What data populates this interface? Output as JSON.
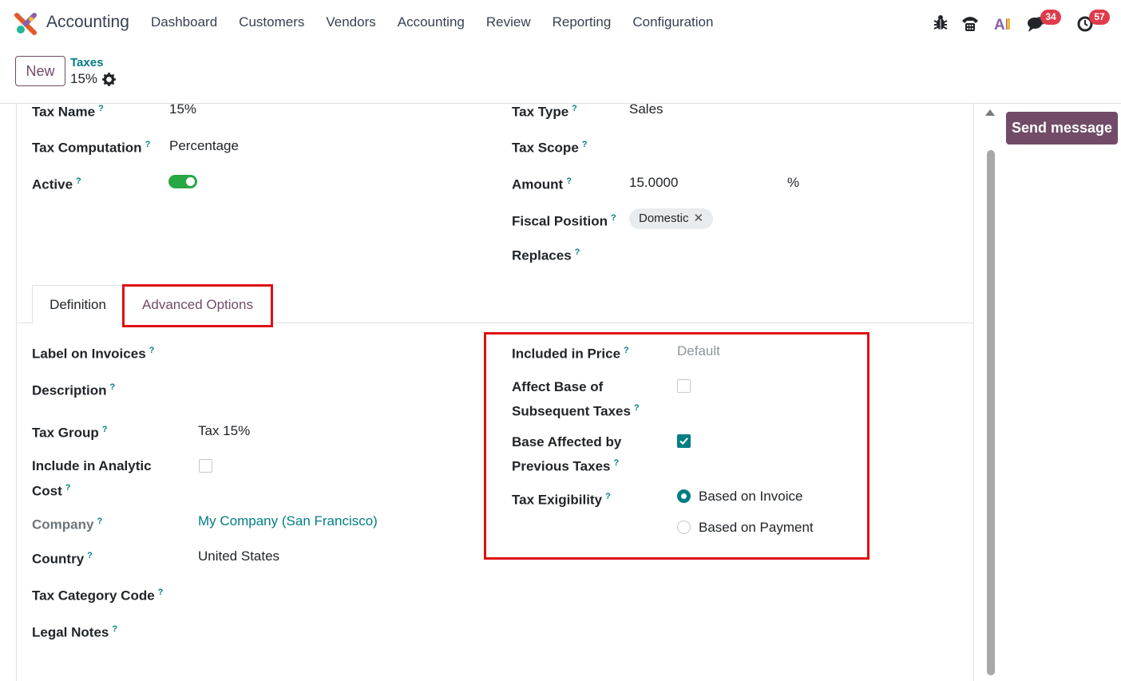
{
  "navbar": {
    "app_name": "Accounting",
    "menu": [
      "Dashboard",
      "Customers",
      "Vendors",
      "Accounting",
      "Review",
      "Reporting",
      "Configuration"
    ],
    "messages_count": "34",
    "activities_count": "57",
    "ai_label": "AI"
  },
  "control": {
    "new_label": "New",
    "breadcrumb_parent": "Taxes",
    "breadcrumb_current": "15%"
  },
  "form": {
    "tax_name_label": "Tax Name",
    "tax_name": "15%",
    "tax_computation_label": "Tax Computation",
    "tax_computation": "Percentage",
    "active_label": "Active",
    "active": true,
    "tax_type_label": "Tax Type",
    "tax_type": "Sales",
    "tax_scope_label": "Tax Scope",
    "amount_label": "Amount",
    "amount": "15.0000",
    "amount_unit": "%",
    "fiscal_position_label": "Fiscal Position",
    "fiscal_position_tag": "Domestic",
    "replaces_label": "Replaces"
  },
  "tabs": {
    "definition": "Definition",
    "advanced": "Advanced Options"
  },
  "advanced": {
    "label_on_invoices": "Label on Invoices",
    "description": "Description",
    "tax_group_label": "Tax Group",
    "tax_group": "Tax 15%",
    "include_analytic_1": "Include in Analytic",
    "include_analytic_2": "Cost",
    "company_label": "Company",
    "company": "My Company (San Francisco)",
    "country_label": "Country",
    "country": "United States",
    "tax_category_code": "Tax Category Code",
    "legal_notes": "Legal Notes",
    "included_in_price_label": "Included in Price",
    "included_in_price": "Default",
    "affect_base_1": "Affect Base of",
    "affect_base_2": "Subsequent Taxes",
    "base_affected_1": "Base Affected by",
    "base_affected_2": "Previous Taxes",
    "exigibility_label": "Tax Exigibility",
    "exigibility_invoice": "Based on Invoice",
    "exigibility_payment": "Based on Payment"
  },
  "chatter": {
    "send_message": "Send message"
  },
  "colors": {
    "brand": "#714b67",
    "teal": "#017e84",
    "highlight": "#e01010"
  }
}
